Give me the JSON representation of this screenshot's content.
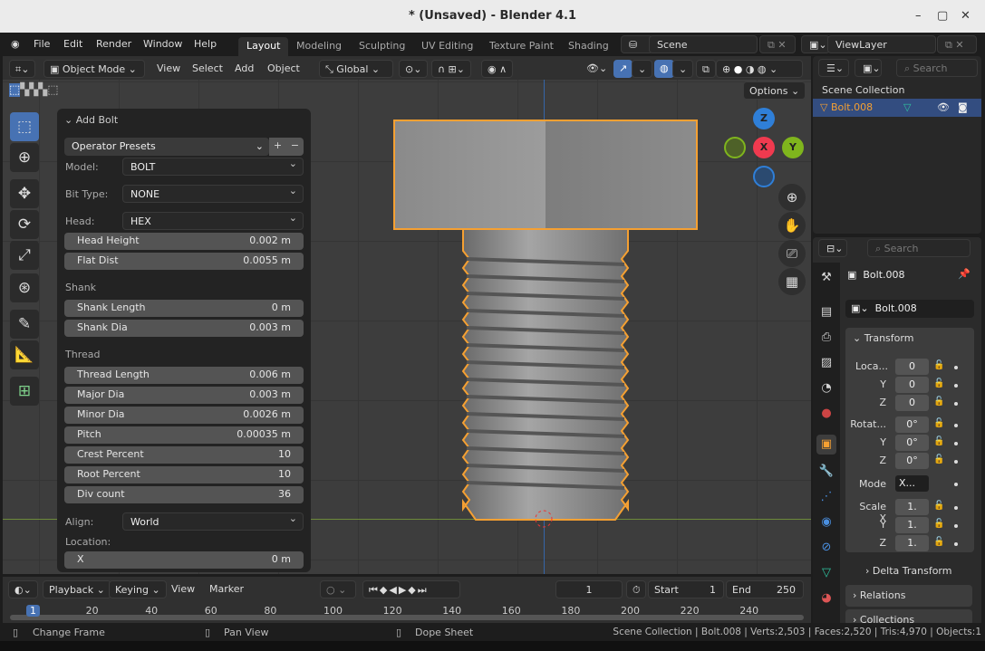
{
  "window": {
    "title": "* (Unsaved) - Blender 4.1",
    "controls": [
      "–",
      "▢",
      "✕"
    ]
  },
  "menu": {
    "items": [
      "File",
      "Edit",
      "Render",
      "Window",
      "Help"
    ],
    "workspaces": [
      "Layout",
      "Modeling",
      "Sculpting",
      "UV Editing",
      "Texture Paint",
      "Shading"
    ],
    "active_workspace": "Layout",
    "scene": "Scene",
    "view_layer": "ViewLayer"
  },
  "viewport_header": {
    "mode": "Object Mode",
    "menus": [
      "View",
      "Select",
      "Add",
      "Object"
    ],
    "orientation": "Global",
    "options": "Options"
  },
  "gizmo": {
    "x": "X",
    "y": "Y",
    "z": "Z"
  },
  "operator": {
    "title": "Add Bolt",
    "presets": "Operator Presets",
    "model_label": "Model:",
    "model": "BOLT",
    "bit_label": "Bit Type:",
    "bit": "NONE",
    "head_label": "Head:",
    "head": "HEX",
    "head_fields": [
      {
        "label": "Head Height",
        "value": "0.002 m"
      },
      {
        "label": "Flat Dist",
        "value": "0.0055 m"
      }
    ],
    "shank_label": "Shank",
    "shank_fields": [
      {
        "label": "Shank Length",
        "value": "0 m"
      },
      {
        "label": "Shank Dia",
        "value": "0.003 m"
      }
    ],
    "thread_label": "Thread",
    "thread_fields": [
      {
        "label": "Thread Length",
        "value": "0.006 m"
      },
      {
        "label": "Major Dia",
        "value": "0.003 m"
      },
      {
        "label": "Minor Dia",
        "value": "0.0026 m"
      },
      {
        "label": "Pitch",
        "value": "0.00035 m"
      },
      {
        "label": "Crest Percent",
        "value": "10"
      },
      {
        "label": "Root Percent",
        "value": "10"
      },
      {
        "label": "Div count",
        "value": "36"
      }
    ],
    "align_label": "Align:",
    "align": "World",
    "location_label": "Location:",
    "loc_x_label": "X",
    "loc_x": "0 m"
  },
  "outliner": {
    "search": "Search",
    "root": "Scene Collection",
    "item": "Bolt.008"
  },
  "properties": {
    "search": "Search",
    "object": "Bolt.008",
    "data_name": "Bolt.008",
    "transform": "Transform",
    "location_label": "Loca...",
    "rotation_label": "Rotat...",
    "scale_label": "Scale X",
    "y": "Y",
    "z": "Z",
    "location": [
      "0",
      "0",
      "0"
    ],
    "rotation": [
      "0°",
      "0°",
      "0°"
    ],
    "mode_label": "Mode",
    "mode": "X...",
    "scale": [
      "1.",
      "1.",
      "1."
    ],
    "delta": "Delta Transform",
    "relations": "Relations",
    "collections": "Collections"
  },
  "timeline": {
    "menus": [
      "Playback",
      "Keying",
      "View",
      "Marker"
    ],
    "current": "1",
    "start_label": "Start",
    "start": "1",
    "end_label": "End",
    "end": "250",
    "ticks": [
      "1",
      "20",
      "40",
      "60",
      "80",
      "100",
      "120",
      "140",
      "160",
      "180",
      "200",
      "220",
      "240"
    ]
  },
  "status": {
    "hints": [
      "Change Frame",
      "Pan View",
      "Dope Sheet"
    ],
    "stats": "Scene Collection | Bolt.008 | Verts:2,503 | Faces:2,520 | Tris:4,970 | Objects:1"
  },
  "colors": {
    "accent": "#4772b3",
    "selection": "#f5a032",
    "x_axis": "#f03a4f",
    "y_axis": "#7fb51d",
    "z_axis": "#2f7fd8"
  }
}
